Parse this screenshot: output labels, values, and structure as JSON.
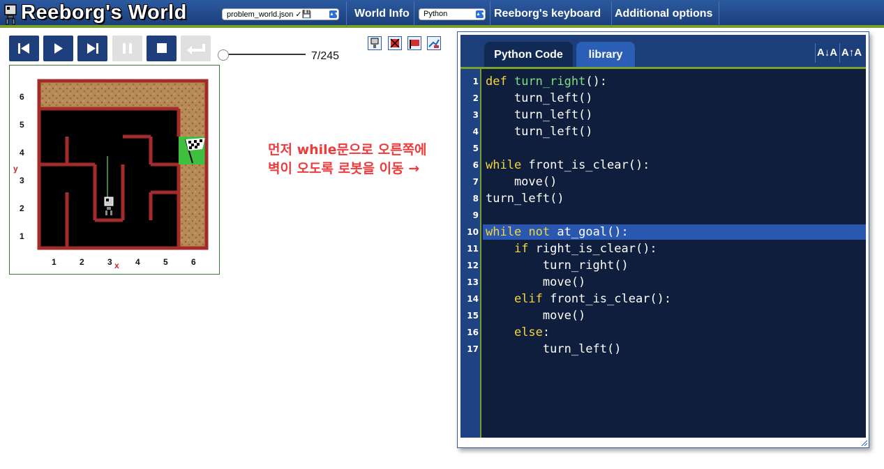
{
  "app": {
    "title": "Reeborg's World"
  },
  "header": {
    "world_select": "problem_world.json ✓💾",
    "world_info": "World Info",
    "language_select": "Python",
    "keyboard": "Reeborg's keyboard",
    "options": "Additional options"
  },
  "controls": {
    "buttons": [
      "reload",
      "run",
      "step",
      "pause",
      "stop",
      "undo"
    ],
    "step_counter": "7/245",
    "slider_position": 0
  },
  "world": {
    "x_labels": [
      "1",
      "2",
      "3",
      "4",
      "5",
      "6"
    ],
    "y_labels": [
      "6",
      "5",
      "4",
      "3",
      "2",
      "1"
    ],
    "x_axis": "x",
    "y_axis": "y"
  },
  "annotation": {
    "line1": "먼저 while문으로 오른쪽에",
    "line2": "벽이 오도록 로봇을 이동 →"
  },
  "editor": {
    "tabs": {
      "python": "Python Code",
      "library": "library"
    },
    "font_decrease": "A↓A",
    "font_increase": "A↑A",
    "highlighted_line": 10,
    "line_numbers": [
      "1",
      "2",
      "3",
      "4",
      "5",
      "6",
      "7",
      "8",
      "9",
      "10",
      "11",
      "12",
      "13",
      "14",
      "15",
      "16",
      "17"
    ],
    "lines": [
      "def turn_right():",
      "    turn_left()",
      "    turn_left()",
      "    turn_left()",
      "",
      "while front_is_clear():",
      "    move()",
      "turn_left()",
      "",
      "while not at_goal():",
      "    if right_is_clear():",
      "        turn_right()",
      "        move()",
      "    elif front_is_clear():",
      "        move()",
      "    else:",
      "        turn_left()"
    ]
  },
  "colors": {
    "header_blue": "#1b3f7a",
    "accent_green": "#7aa02c",
    "wall_red": "#a52a2a",
    "keyword_yellow": "#f5d63b",
    "annotation_red": "#ee3b3b"
  }
}
